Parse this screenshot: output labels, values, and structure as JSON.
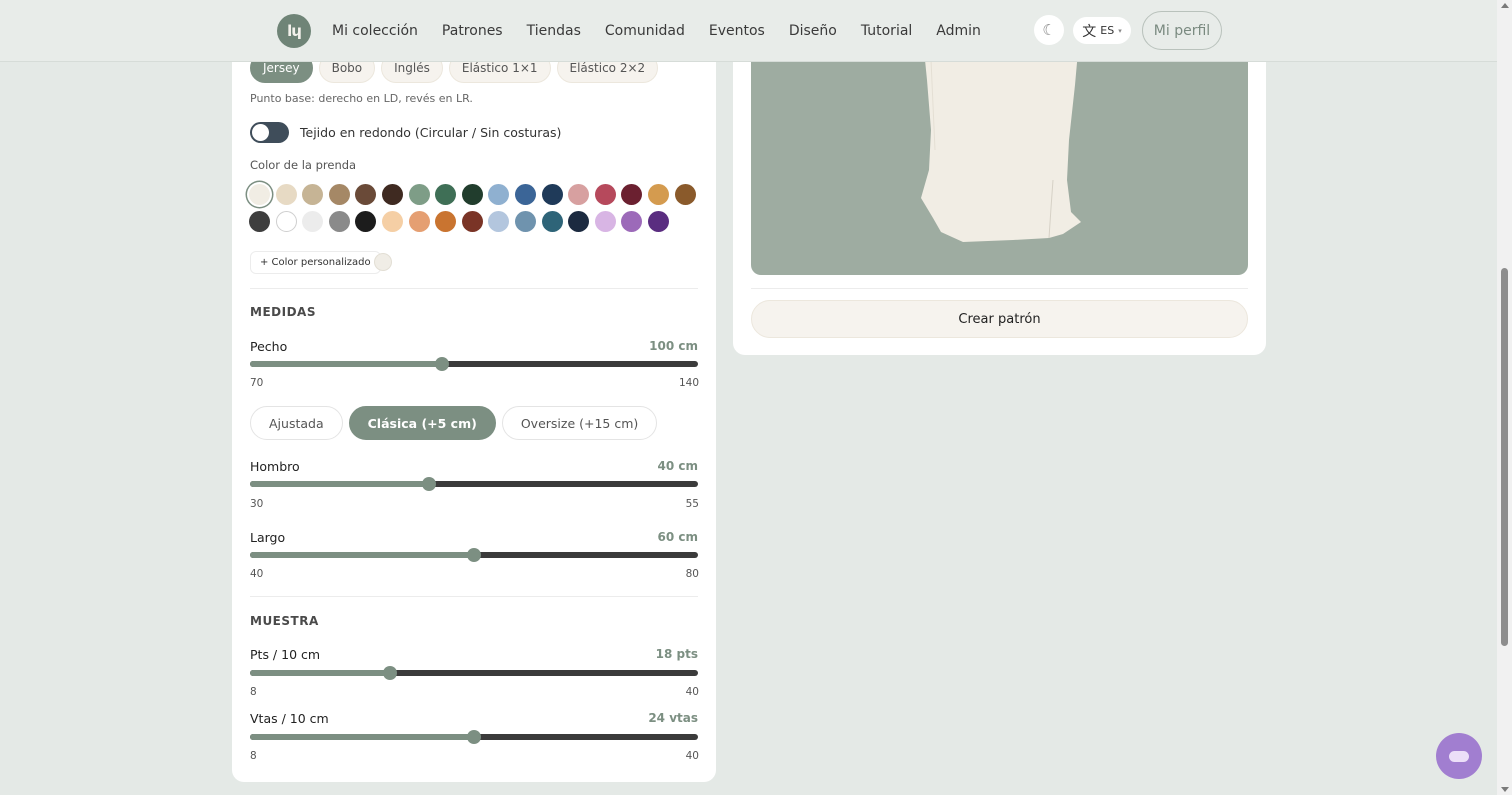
{
  "navbar": {
    "logo_text": "lɥ",
    "items": [
      "Mi colección",
      "Patrones",
      "Tiendas",
      "Comunidad",
      "Eventos",
      "Diseño",
      "Tutorial",
      "Admin"
    ],
    "theme_icon": "☾",
    "lang_glyph": "文",
    "lang_code": "ES",
    "lang_chevron": "▾",
    "profile_label": "Mi perfil"
  },
  "stitch": {
    "chips": [
      "Jersey",
      "Bobo",
      "Inglés",
      "Elástico 1×1",
      "Elástico 2×2"
    ],
    "active": "Jersey",
    "hint": "Punto base: derecho en LD, revés en LR."
  },
  "round_toggle": {
    "label": "Tejido en redondo (Circular / Sin costuras)",
    "on": false
  },
  "garment_color": {
    "label": "Color de la prenda",
    "swatches": [
      "#f1ede4",
      "#e7dac4",
      "#c6b495",
      "#a58866",
      "#6a4a38",
      "#3f2a21",
      "#7e9d87",
      "#3f6f56",
      "#213d2d",
      "#8fb0d0",
      "#3b6597",
      "#1f3a59",
      "#d7a0a0",
      "#b6495c",
      "#6b2030",
      "#d49b4f",
      "#8a5a2b",
      "#3e3e3e",
      "#ffffff",
      "#ececec",
      "#8a8a8a",
      "#1c1c1c",
      "#f5cfa5",
      "#e59f72",
      "#c97430",
      "#7a3426",
      "#b3c6de",
      "#6f93ae",
      "#2e6478",
      "#1c2a40",
      "#d8b5e4",
      "#9c6ab9",
      "#5a2d80"
    ],
    "selected_index": 0,
    "custom_label": "+ Color personalizado",
    "custom_color": "#f0ede6"
  },
  "medidas": {
    "title": "MEDIDAS",
    "pecho": {
      "label": "Pecho",
      "value": "100 cm",
      "min": "70",
      "max": "140",
      "num": 100,
      "lo": 70,
      "hi": 140
    },
    "fit_chips": [
      "Ajustada",
      "Clásica (+5 cm)",
      "Oversize (+15 cm)"
    ],
    "fit_active": "Clásica (+5 cm)",
    "hombro": {
      "label": "Hombro",
      "value": "40 cm",
      "min": "30",
      "max": "55",
      "num": 40,
      "lo": 30,
      "hi": 55
    },
    "largo": {
      "label": "Largo",
      "value": "60 cm",
      "min": "40",
      "max": "80",
      "num": 60,
      "lo": 40,
      "hi": 80
    }
  },
  "muestra": {
    "title": "MUESTRA",
    "pts": {
      "label": "Pts / 10 cm",
      "value": "18 pts",
      "min": "8",
      "max": "40",
      "num": 18,
      "lo": 8,
      "hi": 40
    },
    "vtas": {
      "label": "Vtas / 10 cm",
      "value": "24 vtas",
      "min": "8",
      "max": "40",
      "num": 24,
      "lo": 8,
      "hi": 40
    }
  },
  "preview": {
    "bg_color": "#9eaca1",
    "garment_color": "#f1ede4"
  },
  "create_button": "Crear patrón"
}
